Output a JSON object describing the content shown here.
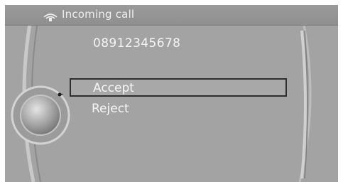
{
  "header": {
    "title": "Incoming call",
    "icon": "phone-signal-icon"
  },
  "call": {
    "number": "08912345678"
  },
  "menu": {
    "items": [
      {
        "label": "Accept",
        "selected": true
      },
      {
        "label": "Reject",
        "selected": false
      }
    ]
  },
  "colors": {
    "background": "#a3a3a3",
    "text": "#f4f4f4",
    "selection_border": "#2e2e2e"
  }
}
